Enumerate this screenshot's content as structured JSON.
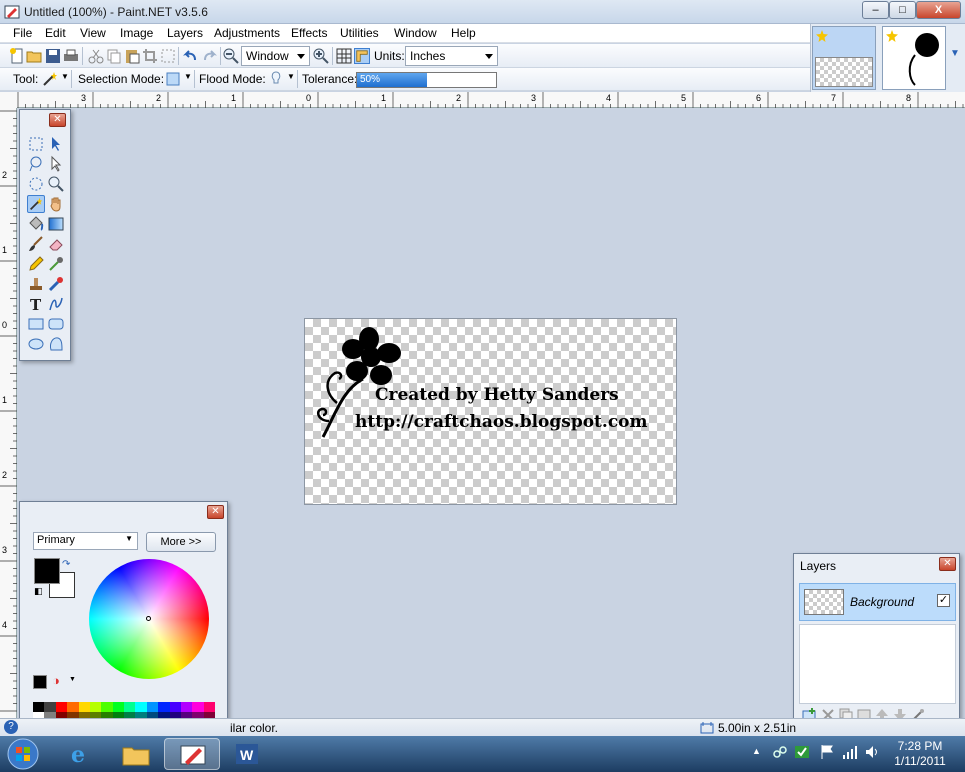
{
  "window": {
    "title": "Untitled (100%) - Paint.NET v3.5.6",
    "min_label": "–",
    "max_label": "□",
    "close_label": "X"
  },
  "menu": [
    "File",
    "Edit",
    "View",
    "Image",
    "Layers",
    "Adjustments",
    "Effects",
    "Utilities",
    "Window",
    "Help"
  ],
  "toolbar": {
    "zoom_value": "Window",
    "units_label": "Units:",
    "units_value": "Inches",
    "tool_label": "Tool:",
    "selection_mode_label": "Selection Mode:",
    "flood_mode_label": "Flood Mode:",
    "tolerance_label": "Tolerance:",
    "tolerance_value": "50%",
    "tolerance_fraction": 0.5
  },
  "ruler": {
    "top_labels": [
      "3",
      "2",
      "1",
      "0",
      "1",
      "2",
      "3",
      "4",
      "5",
      "6",
      "7",
      "8"
    ],
    "left_labels": [
      "2",
      "1",
      "0",
      "1",
      "2",
      "3",
      "4"
    ]
  },
  "canvas": {
    "line1": "Created by Hetty Sanders",
    "line2": "http://craftchaos.blogspot.com"
  },
  "colors_window": {
    "primary_select": "Primary",
    "more_button": "More >>",
    "palette": [
      "#000000",
      "#404040",
      "#ff0000",
      "#ff6a00",
      "#ffd800",
      "#b6ff00",
      "#4cff00",
      "#00ff21",
      "#00ff90",
      "#00ffff",
      "#0094ff",
      "#0026ff",
      "#4800ff",
      "#b200ff",
      "#ff00dc",
      "#ff006e",
      "#ffffff",
      "#808080",
      "#7f0000",
      "#7f3300",
      "#7f6a00",
      "#5b7f00",
      "#267f00",
      "#007f0e",
      "#007f46",
      "#007f7f",
      "#004a7f",
      "#00137f",
      "#21007f",
      "#57007f",
      "#7f006e",
      "#7f0037"
    ]
  },
  "layers_window": {
    "title": "Layers",
    "layer_name": "Background",
    "layer_visible": "✓"
  },
  "status": {
    "text": "ilar color.",
    "size": "5.00in x 2.51in"
  },
  "taskbar": {
    "time": "7:28 PM",
    "date": "1/11/2011"
  }
}
